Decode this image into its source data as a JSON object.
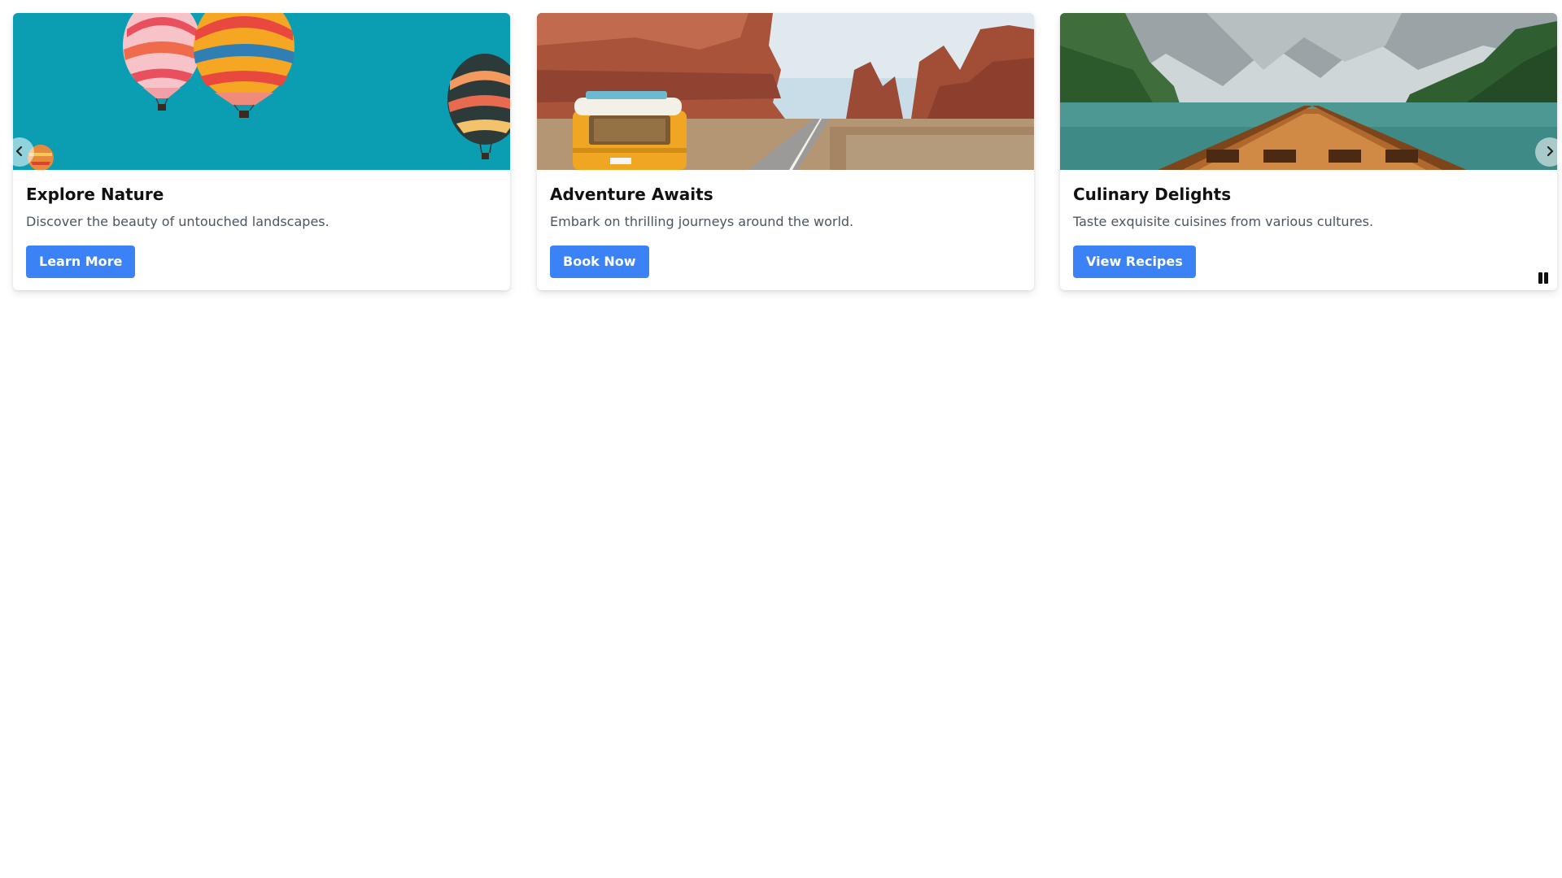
{
  "cards": [
    {
      "title": "Explore Nature",
      "description": "Discover the beauty of untouched landscapes.",
      "button_label": "Learn More",
      "image_icon": "hot-air-balloons-image"
    },
    {
      "title": "Adventure Awaits",
      "description": "Embark on thrilling journeys around the world.",
      "button_label": "Book Now",
      "image_icon": "desert-road-van-image"
    },
    {
      "title": "Culinary Delights",
      "description": "Taste exquisite cuisines from various cultures.",
      "button_label": "View Recipes",
      "image_icon": "mountain-lake-boat-image"
    }
  ],
  "controls": {
    "prev_icon": "chevron-left-icon",
    "next_icon": "chevron-right-icon",
    "pause_icon": "pause-icon"
  },
  "colors": {
    "button_bg": "#3b82f6",
    "button_text": "#ffffff",
    "title_text": "#111111",
    "description_text": "#4b5563"
  }
}
